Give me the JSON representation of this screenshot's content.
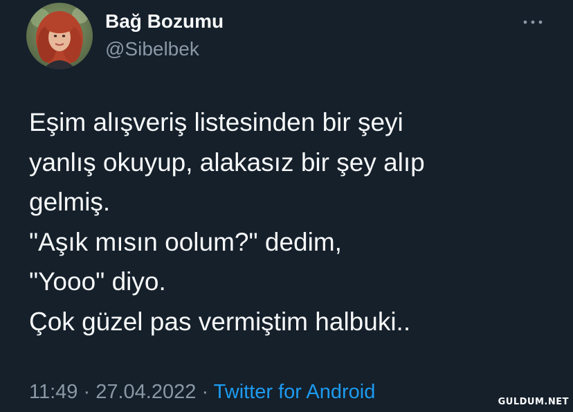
{
  "author": {
    "display_name": "Bağ Bozumu",
    "handle": "@Sibelbek"
  },
  "more_icon": "more-horizontal-icon",
  "tweet": {
    "lines": [
      "Eşim alışveriş listesinden bir şeyi",
      "yanlış okuyup, alakasız bir şey alıp",
      "gelmiş.",
      "\"Aşık mısın oolum?\" dedim,",
      "\"Yooo\" diyo.",
      "Çok güzel pas vermiştim halbuki.."
    ]
  },
  "meta": {
    "time": "11:49",
    "separator": "·",
    "date": "27.04.2022",
    "source": "Twitter for Android"
  },
  "watermark": "GULDUM.NET",
  "colors": {
    "background": "#15202b",
    "text": "#f7f9f9",
    "secondary": "#8b98a5",
    "link": "#1d9bf0"
  }
}
